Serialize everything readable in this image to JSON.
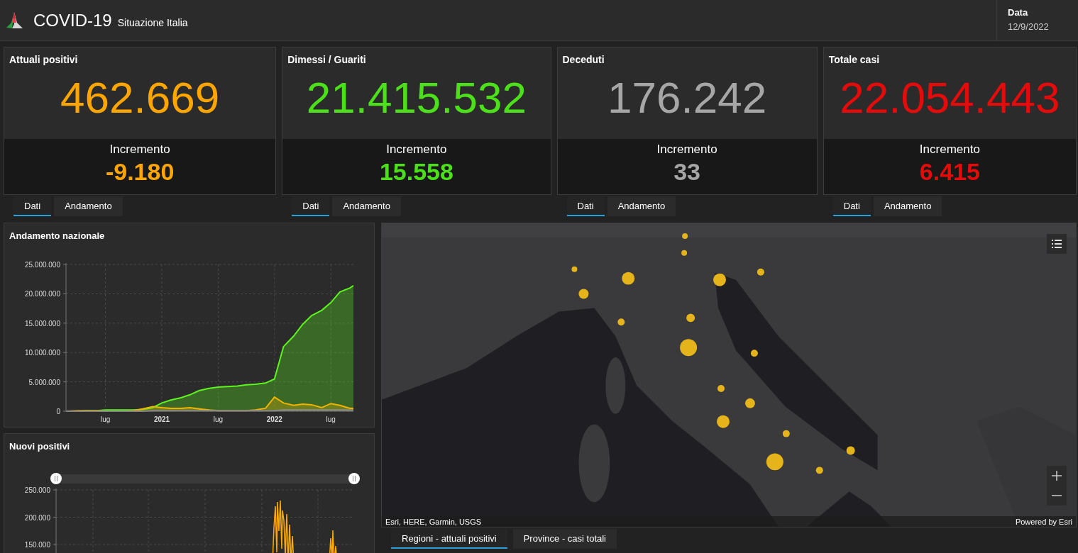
{
  "header": {
    "title": "COVID-19",
    "subtitle": "Situazione Italia",
    "date_label": "Data",
    "date": "12/9/2022"
  },
  "cards": [
    {
      "title": "Attuali positivi",
      "value": "462.669",
      "increment_label": "Incremento",
      "increment": "-9.180",
      "color": "#ffa500",
      "tabs": [
        {
          "label": "Dati",
          "selected": true
        },
        {
          "label": "Andamento",
          "selected": false
        }
      ]
    },
    {
      "title": "Dimessi / Guariti",
      "value": "21.415.532",
      "increment_label": "Incremento",
      "increment": "15.558",
      "color": "#4ce01a",
      "tabs": [
        {
          "label": "Dati",
          "selected": true
        },
        {
          "label": "Andamento",
          "selected": false
        }
      ]
    },
    {
      "title": "Deceduti",
      "value": "176.242",
      "increment_label": "Incremento",
      "increment": "33",
      "color": "#a6a6a6",
      "tabs": [
        {
          "label": "Dati",
          "selected": true
        },
        {
          "label": "Andamento",
          "selected": false
        }
      ]
    },
    {
      "title": "Totale casi",
      "value": "22.054.443",
      "increment_label": "Incremento",
      "increment": "6.415",
      "color": "#e50b0b",
      "tabs": [
        {
          "label": "Dati",
          "selected": true
        },
        {
          "label": "Andamento",
          "selected": false
        }
      ]
    }
  ],
  "trend_panel": {
    "title": "Andamento nazionale",
    "chart_data": {
      "type": "area",
      "grid": true,
      "x": [
        2020.15,
        2020.25,
        2020.33,
        2020.42,
        2020.5,
        2020.58,
        2020.67,
        2020.75,
        2020.83,
        2020.92,
        2021,
        2021.08,
        2021.17,
        2021.25,
        2021.33,
        2021.42,
        2021.5,
        2021.58,
        2021.67,
        2021.75,
        2021.83,
        2021.92,
        2022,
        2022.08,
        2022.17,
        2022.25,
        2022.33,
        2022.42,
        2022.5,
        2022.58,
        2022.67,
        2022.7
      ],
      "series": [
        {
          "color": "#5cf51f",
          "values": [
            0,
            0,
            100000,
            100000,
            200000,
            200000,
            200000,
            200000,
            300000,
            600000,
            1400000,
            1900000,
            2300000,
            2800000,
            3500000,
            3900000,
            4100000,
            4200000,
            4300000,
            4500000,
            4600000,
            4800000,
            5500000,
            11000000,
            12800000,
            14800000,
            16300000,
            17200000,
            18500000,
            20300000,
            21000000,
            21400000
          ]
        },
        {
          "color": "#f0b400",
          "values": [
            0,
            100000,
            100000,
            100000,
            0,
            0,
            0,
            100000,
            400000,
            800000,
            600000,
            500000,
            500000,
            600000,
            400000,
            200000,
            100000,
            100000,
            100000,
            100000,
            200000,
            500000,
            2400000,
            1400000,
            1000000,
            1200000,
            1100000,
            600000,
            1300000,
            1000000,
            500000,
            500000
          ]
        },
        {
          "color": "#8c8c8c",
          "values": [
            0,
            0,
            0,
            0,
            0,
            0,
            0,
            0,
            0,
            100000,
            100000,
            100000,
            100000,
            100000,
            100000,
            100000,
            100000,
            100000,
            100000,
            100000,
            100000,
            100000,
            100000,
            200000,
            200000,
            200000,
            200000,
            200000,
            200000,
            200000,
            200000,
            200000
          ]
        }
      ],
      "xlim": [
        2020.15,
        2022.7
      ],
      "ylim": [
        0,
        25000000
      ],
      "xticks": [
        {
          "value": 2020.5,
          "label": "lug"
        },
        2021,
        {
          "value": 2021.5,
          "label": "lug"
        },
        2022,
        {
          "value": 2022.5,
          "label": "lug"
        }
      ],
      "yticks": [
        0,
        {
          "value": 5000000,
          "label": "5.000.000"
        },
        {
          "value": 10000000,
          "label": "10.000.000"
        },
        {
          "value": 15000000,
          "label": "15.000.000"
        },
        {
          "value": 20000000,
          "label": "20.000.000"
        },
        {
          "value": 25000000,
          "label": "25.000.000"
        }
      ]
    }
  },
  "new_cases_panel": {
    "title": "Nuovi positivi",
    "y_labels": [
      "250.000",
      "200.000",
      "150.000"
    ]
  },
  "map": {
    "kind": "picture",
    "attribution": "Esri, HERE, Garmin, USGS",
    "powered_by": "Powered by Esri",
    "tabs": [
      {
        "label": "Regioni - attuali positivi",
        "selected": true
      },
      {
        "label": "Province - casi totali",
        "selected": false
      }
    ]
  }
}
